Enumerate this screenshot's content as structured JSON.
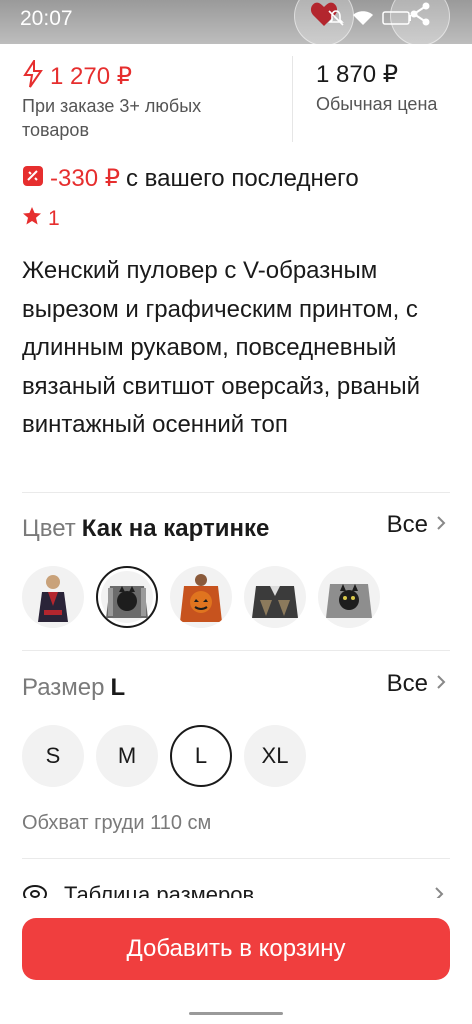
{
  "status_bar": {
    "time": "20:07",
    "battery": "62"
  },
  "price": {
    "promo_value": "1 270 ₽",
    "promo_note": "При заказе 3+ любых товаров",
    "regular_value": "1 870 ₽",
    "regular_note": "Обычная цена"
  },
  "discount": {
    "value": "-330 ₽",
    "text": "с вашего последнего"
  },
  "rating": {
    "count": "1"
  },
  "product_title": "Женский пуловер с V-образным вырезом и графическим принтом, с длинным рукавом, повседневный вязаный свитшот оверсайз, рваный винтажный осенний топ",
  "color_section": {
    "label": "Цвет",
    "value": "Как на картинке",
    "all_label": "Все",
    "selected_index": 1,
    "swatch_count": 5
  },
  "size_section": {
    "label": "Размер",
    "value": "L",
    "all_label": "Все",
    "options": [
      "S",
      "M",
      "L",
      "XL"
    ],
    "selected": "L",
    "chest_note": "Обхват груди 110 см"
  },
  "size_table": {
    "label": "Таблица размеров"
  },
  "cta": {
    "add_to_cart": "Добавить в корзину"
  },
  "colors": {
    "accent": "#f03e3e",
    "price_red": "#e62e2e",
    "muted": "#7a7a7a"
  }
}
